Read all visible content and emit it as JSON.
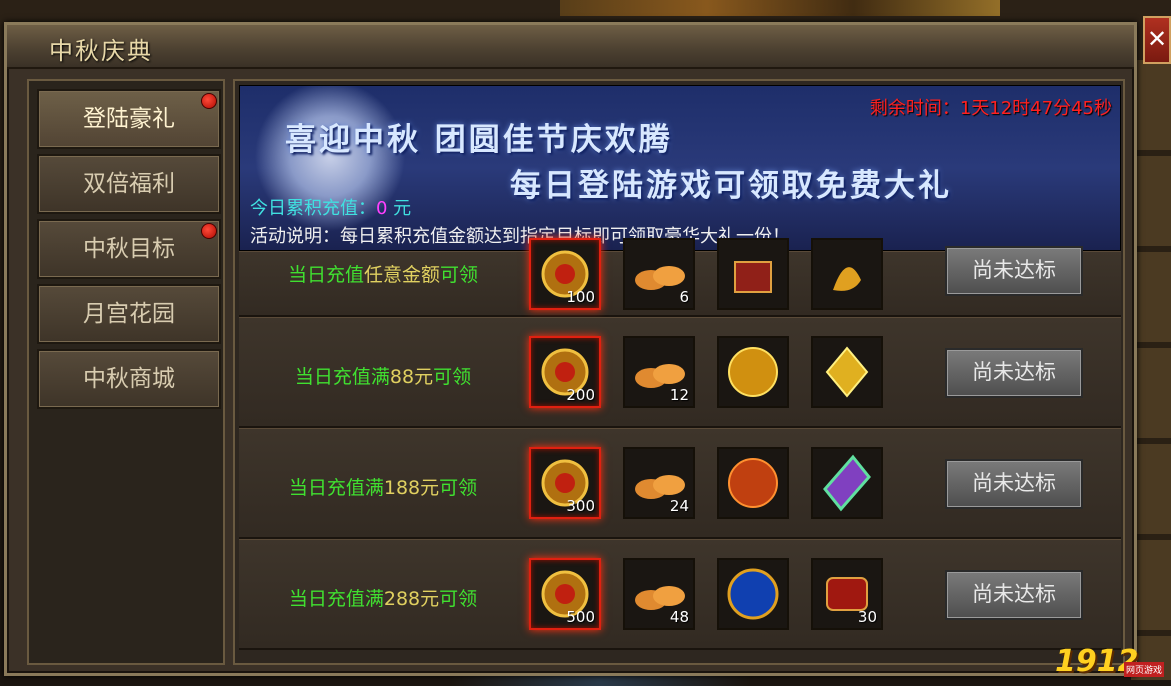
{
  "window": {
    "title": "中秋庆典",
    "close_label": "✕"
  },
  "sidebar": {
    "tabs": [
      {
        "label": "登陆豪礼",
        "active": true,
        "has_dot": true
      },
      {
        "label": "双倍福利",
        "active": false,
        "has_dot": false
      },
      {
        "label": "中秋目标",
        "active": false,
        "has_dot": true
      },
      {
        "label": "月宫花园",
        "active": false,
        "has_dot": false
      },
      {
        "label": "中秋商城",
        "active": false,
        "has_dot": false
      }
    ]
  },
  "banner": {
    "line1": "喜迎中秋 团圆佳节庆欢腾",
    "line2": "每日登陆游戏可领取免费大礼",
    "countdown": "剩余时间：1天12时47分45秒",
    "recharge_label": "今日累积充值：",
    "recharge_value": "0",
    "recharge_unit": " 元",
    "description": "活动说明：每日累积充值金额达到指定目标即可领取豪华大礼一份！"
  },
  "rewards": [
    {
      "prefix": "当日充值",
      "amount": "任意金额",
      "suffix": "可领",
      "items": [
        {
          "icon": "token-icon",
          "count": "100"
        },
        {
          "icon": "mooncake-icon",
          "count": "6"
        },
        {
          "icon": "treasure-chest-icon",
          "count": ""
        },
        {
          "icon": "gold-ornament-icon",
          "count": ""
        }
      ],
      "button": "尚未达标"
    },
    {
      "prefix": "当日充值满",
      "amount": "88元",
      "suffix": "可领",
      "items": [
        {
          "icon": "token-icon",
          "count": "200"
        },
        {
          "icon": "mooncake-icon",
          "count": "12"
        },
        {
          "icon": "gold-orb-icon",
          "count": ""
        },
        {
          "icon": "gold-crystal-icon",
          "count": ""
        }
      ],
      "button": "尚未达标"
    },
    {
      "prefix": "当日充值满",
      "amount": "188元",
      "suffix": "可领",
      "items": [
        {
          "icon": "token-icon",
          "count": "300"
        },
        {
          "icon": "mooncake-icon",
          "count": "24"
        },
        {
          "icon": "fire-orb-icon",
          "count": ""
        },
        {
          "icon": "rainbow-gem-icon",
          "count": ""
        }
      ],
      "button": "尚未达标"
    },
    {
      "prefix": "当日充值满",
      "amount": "288元",
      "suffix": "可领",
      "items": [
        {
          "icon": "token-icon",
          "count": "500"
        },
        {
          "icon": "mooncake-icon",
          "count": "48"
        },
        {
          "icon": "blue-orb-icon",
          "count": ""
        },
        {
          "icon": "red-scroll-icon",
          "count": "30"
        }
      ],
      "button": "尚未达标"
    }
  ],
  "watermark": {
    "logo": "1912",
    "sub": "网页游戏"
  }
}
